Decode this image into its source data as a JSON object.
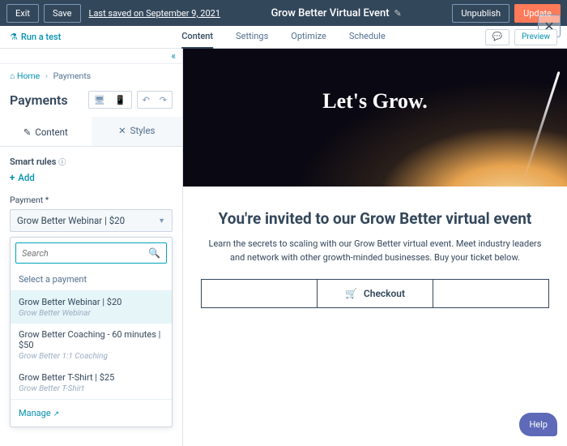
{
  "topbar": {
    "exit": "Exit",
    "save": "Save",
    "saved": "Last saved on September 9, 2021",
    "title": "Grow Better Virtual Event",
    "unpublish": "Unpublish",
    "update": "Update"
  },
  "subbar": {
    "test": "Run a test",
    "tabs": [
      "Content",
      "Settings",
      "Optimize",
      "Schedule"
    ],
    "preview": "Preview"
  },
  "crumb": {
    "home": "Home",
    "sep": "›",
    "current": "Payments"
  },
  "panel": {
    "title": "Payments",
    "tab_content": "Content",
    "tab_styles": "Styles",
    "rules": "Smart rules",
    "add": "Add"
  },
  "field": {
    "label": "Payment *",
    "value": "Grow Better Webinar | $20"
  },
  "dropdown": {
    "search_placeholder": "Search",
    "header": "Select a payment",
    "options": [
      {
        "label": "Grow Better Webinar | $20",
        "sub": "Grow Better Webinar"
      },
      {
        "label": "Grow Better Coaching - 60 minutes | $50",
        "sub": "Grow Better 1:1 Coaching"
      },
      {
        "label": "Grow Better T-Shirt | $25",
        "sub": "Grow Better T-Shirt"
      }
    ],
    "manage": "Manage"
  },
  "hero": {
    "headline": "Let's Grow."
  },
  "page": {
    "heading": "You're invited to our Grow Better virtual event",
    "body": "Learn the secrets to scaling with our Grow Better virtual event. Meet industry leaders and network with other growth-minded businesses. Buy your ticket below.",
    "checkout": "Checkout"
  },
  "help": "Help"
}
